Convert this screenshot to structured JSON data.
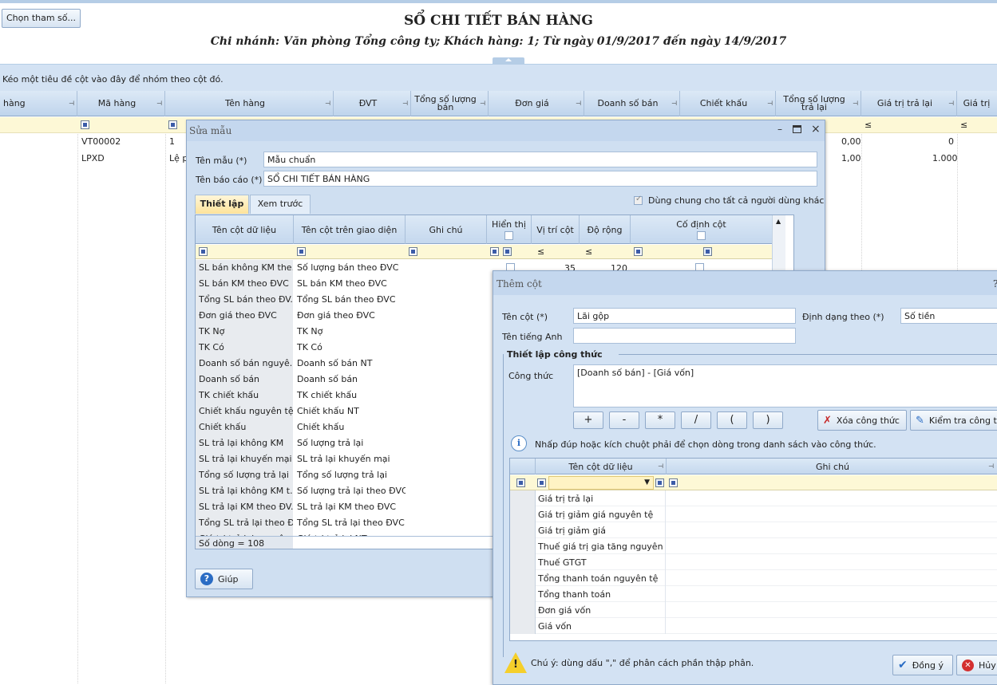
{
  "report": {
    "params_button": "Chọn tham số...",
    "title": "SỔ CHI TIẾT BÁN HÀNG",
    "subtitle": "Chi nhánh: Văn phòng Tổng công ty; Khách hàng: 1; Từ ngày 01/9/2017 đến ngày 14/9/2017",
    "group_hint": "Kéo một tiêu đề cột vào đây để nhóm theo cột đó."
  },
  "main_grid": {
    "columns": [
      "hàng",
      "Mã hàng",
      "Tên hàng",
      "ĐVT",
      "Tổng số lượng bán",
      "Đơn giá",
      "Doanh số bán",
      "Chiết khấu",
      "Tổng số lượng trả lại",
      "Giá trị trả lại",
      "Giá trị"
    ],
    "filter_ops": [
      "≤",
      "≤"
    ],
    "rows": [
      {
        "ma_hang": "VT00002",
        "ten_hang": "1",
        "sl_tra_lai": "0,00",
        "gt_tra_lai": "0"
      },
      {
        "ma_hang": "LPXD",
        "ten_hang": "Lệ p",
        "sl_tra_lai": "1,00",
        "gt_tra_lai": "1.000"
      }
    ]
  },
  "edit_template_dialog": {
    "title": "Sửa mẫu",
    "template_name_label": "Tên mẫu (*)",
    "template_name_value": "Mẫu chuẩn",
    "report_name_label": "Tên báo cáo (*)",
    "report_name_value": "SỔ CHI TIẾT BÁN HÀNG",
    "tabs": [
      "Thiết lập",
      "Xem trước"
    ],
    "share_label": "Dùng chung cho tất cả người dùng khác",
    "columns": [
      "Tên cột dữ liệu",
      "Tên cột trên giao diện",
      "Ghi chú",
      "Hiển thị",
      "Vị trí cột",
      "Độ rộng",
      "Cố định cột"
    ],
    "filter_ops": [
      "≤",
      "≤"
    ],
    "first_row": {
      "position": "35",
      "width": "120"
    },
    "rows": [
      [
        "SL bán không KM the...",
        "Số lượng bán theo ĐVC"
      ],
      [
        "SL bán KM theo ĐVC",
        "SL bán KM theo ĐVC"
      ],
      [
        "Tổng SL bán theo ĐV...",
        "Tổng SL bán theo ĐVC"
      ],
      [
        "Đơn giá theo ĐVC",
        "Đơn giá theo ĐVC"
      ],
      [
        "TK Nợ",
        "TK Nợ"
      ],
      [
        "TK Có",
        "TK Có"
      ],
      [
        "Doanh số bán nguyê...",
        "Doanh số bán NT"
      ],
      [
        "Doanh số bán",
        "Doanh số bán"
      ],
      [
        "TK chiết khấu",
        "TK chiết khấu"
      ],
      [
        "Chiết khấu nguyên tệ",
        "Chiết khấu NT"
      ],
      [
        "Chiết khấu",
        "Chiết khấu"
      ],
      [
        "SL trả lại không KM",
        "Số lượng trả lại"
      ],
      [
        "SL trả lại khuyến mại",
        "SL trả lại khuyến mại"
      ],
      [
        "Tổng số lượng trả lại",
        "Tổng số lượng trả lại"
      ],
      [
        "SL trả lại không KM t...",
        "Số lượng trả lại theo ĐVC"
      ],
      [
        "SL trả lại KM theo ĐV...",
        "SL trả lại KM theo ĐVC"
      ],
      [
        "Tổng SL trả lại theo Đ...",
        "Tổng SL trả lại theo ĐVC"
      ],
      [
        "Giá trị trả lại nguyên tệ",
        "Giá trị trả lại NT"
      ]
    ],
    "row_count": "Số dòng = 108",
    "help_button": "Giúp"
  },
  "add_column_dialog": {
    "title": "Thêm cột",
    "col_name_label": "Tên cột (*)",
    "col_name_value": "Lãi gộp",
    "format_label": "Định dạng theo (*)",
    "format_value": "Số tiền",
    "english_label": "Tên tiếng Anh",
    "english_value": "",
    "formula_section": "Thiết lập công thức",
    "formula_label": "Công thức",
    "formula_value": "[Doanh số bán] - [Giá vốn]",
    "operators": [
      "+",
      "-",
      "*",
      "/",
      "(",
      ")"
    ],
    "clear_button": "Xóa công thức",
    "check_button": "Kiểm tra công thức",
    "hint": "Nhấp đúp hoặc kích chuột phải để chọn dòng trong danh sách vào công thức.",
    "columns": [
      "Tên cột dữ liệu",
      "Ghi chú"
    ],
    "rows": [
      "Giá trị trả lại",
      "Giá trị giảm giá nguyên tệ",
      "Giá trị giảm giá",
      "Thuế giá trị gia tăng nguyên tệ",
      "Thuế GTGT",
      "Tổng thanh toán nguyên tệ",
      "Tổng thanh toán",
      "Đơn giá vốn",
      "Giá vốn"
    ],
    "note": "Chú ý: dùng dấu \",\" để phân cách phần thập phân.",
    "ok_button": "Đồng ý",
    "cancel_button": "Hủy"
  }
}
